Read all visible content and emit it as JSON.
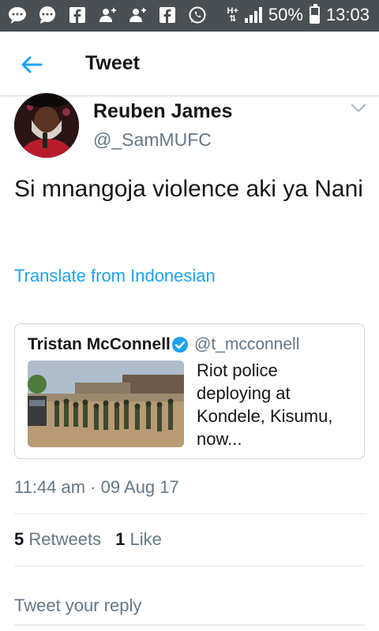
{
  "status_bar": {
    "battery": "50%",
    "time": "13:03",
    "network_label": "H+",
    "battery_level": 0.5,
    "icons": [
      "messenger-icon",
      "chat-bubble-icon",
      "facebook-icon",
      "add-user-icon",
      "add-user-icon",
      "facebook-icon",
      "whatsapp-icon"
    ]
  },
  "header": {
    "title": "Tweet",
    "back_icon": "arrow-left-icon"
  },
  "tweet": {
    "author_name": "Reuben James",
    "author_handle": "@_SamMUFC",
    "text": "Si mnangoja violence aki ya Nani",
    "translate_label": "Translate from Indonesian",
    "timestamp": "11:44 am · 09 Aug 17",
    "retweets_count": "5",
    "retweets_label": "Retweets",
    "likes_count": "1",
    "likes_label": "Like"
  },
  "quoted_tweet": {
    "author_name": "Tristan McConnell",
    "author_handle": "@t_mcconnell",
    "text": "Riot police deploying at Kondele, Kisumu, now...",
    "verified": true
  },
  "reply": {
    "placeholder": "Tweet your reply"
  },
  "colors": {
    "accent": "#1da1f2",
    "secondary_text": "#657786",
    "status_bar": "#4a4f54"
  }
}
